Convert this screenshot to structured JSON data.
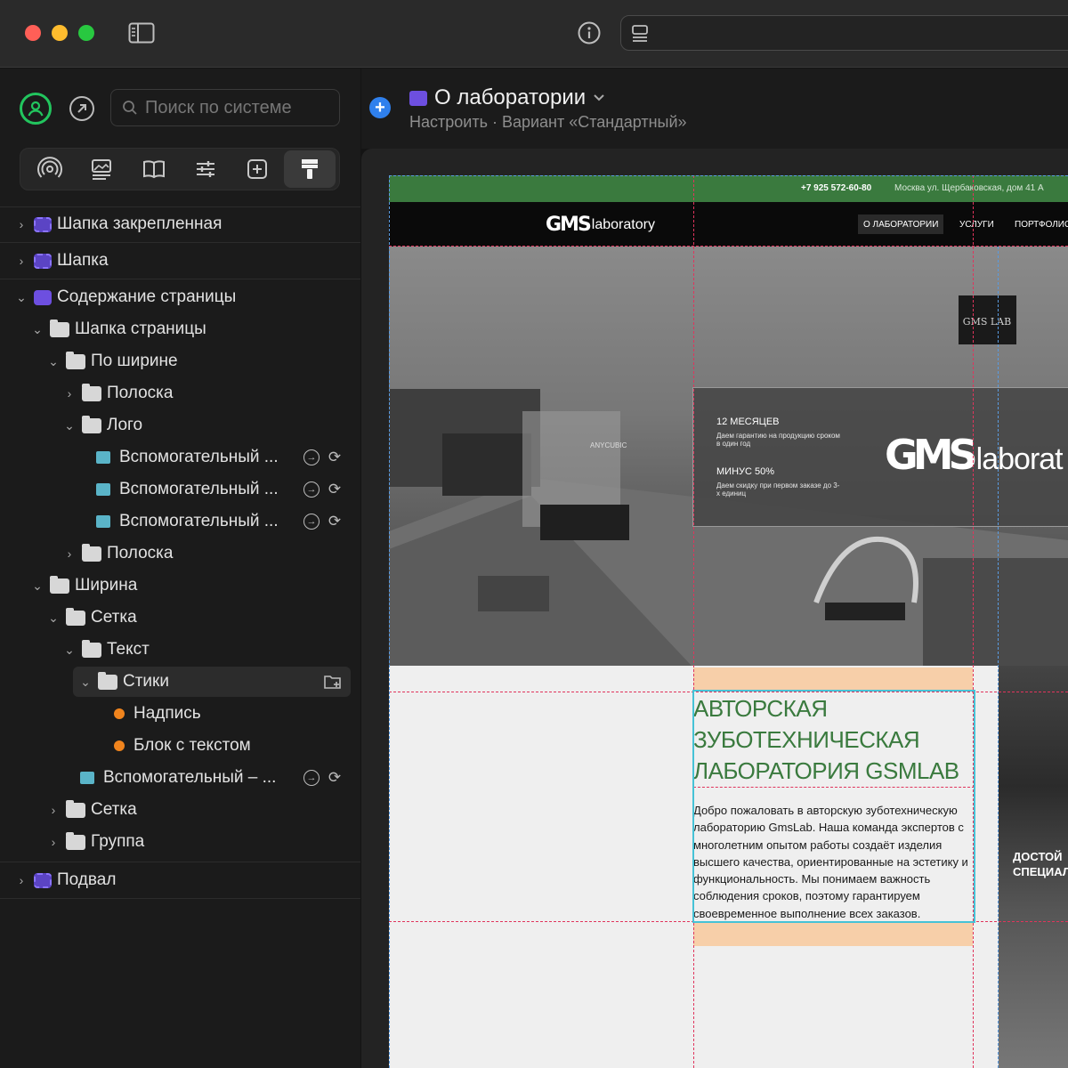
{
  "window": {
    "traffic_lights": {
      "close": "#ff5f57",
      "minimize": "#febc2e",
      "maximize": "#28c840"
    }
  },
  "sidebar": {
    "search_placeholder": "Поиск по системе",
    "toolbar_icons": [
      "broadcast-icon",
      "image-gallery-icon",
      "book-icon",
      "sliders-icon",
      "plus-square-icon",
      "paint-roller-icon"
    ],
    "tree": [
      {
        "label": "Шапка закрепленная",
        "type": "component",
        "expanded": false
      },
      {
        "label": "Шапка",
        "type": "component",
        "expanded": false
      },
      {
        "label": "Содержание страницы",
        "type": "component",
        "expanded": true
      },
      {
        "label": "Шапка страницы",
        "type": "folder",
        "expanded": true
      },
      {
        "label": "По ширине",
        "type": "folder",
        "expanded": true
      },
      {
        "label": "Полоска",
        "type": "folder",
        "expanded": false
      },
      {
        "label": "Лого",
        "type": "folder",
        "expanded": true
      },
      {
        "label": "Вспомогательный ...",
        "type": "auxiliary"
      },
      {
        "label": "Вспомогательный ...",
        "type": "auxiliary"
      },
      {
        "label": "Вспомогательный ...",
        "type": "auxiliary"
      },
      {
        "label": "Полоска",
        "type": "folder",
        "expanded": false
      },
      {
        "label": "Ширина",
        "type": "folder",
        "expanded": true
      },
      {
        "label": "Сетка",
        "type": "folder",
        "expanded": true
      },
      {
        "label": "Текст",
        "type": "folder",
        "expanded": true
      },
      {
        "label": "Стики",
        "type": "folder",
        "expanded": true,
        "selected": true
      },
      {
        "label": "Надпись",
        "type": "element"
      },
      {
        "label": "Блок с текстом",
        "type": "element"
      },
      {
        "label": "Вспомогательный – ...",
        "type": "auxiliary"
      },
      {
        "label": "Сетка",
        "type": "folder",
        "expanded": false
      },
      {
        "label": "Группа",
        "type": "folder",
        "expanded": false
      },
      {
        "label": "Подвал",
        "type": "component",
        "expanded": false
      }
    ]
  },
  "header": {
    "title": "О лаборатории",
    "subtitle": "Настроить · Вариант «Стандартный»"
  },
  "site": {
    "phone": "+7 925 572-60-80",
    "address": "Москва ул. Щербаковская, дом 41 А",
    "logo_mark": "GMS",
    "logo_text": "laboratory",
    "nav": [
      "О ЛАБОРАТОРИИ",
      "УСЛУГИ",
      "ПОРТФОЛИО"
    ],
    "card": {
      "h1": "12 МЕСЯЦЕВ",
      "p1": "Даем гарантию на продукцию сроком в один год",
      "h2": "МИНУС 50%",
      "p2": "Даем скидку при первом заказе до 3-х единиц",
      "logo_text": "laborat"
    },
    "sign_text": "GMS LAB",
    "printer_label": "ANYCUBIC",
    "heading": "АВТОРСКАЯ ЗУБОТЕХНИЧЕСКАЯ ЛАБОРАТОРИЯ GSMLAB",
    "body": "Добро пожаловать в авторскую зуботехническую лабораторию GmsLab. Наша команда экспертов с многолетним опытом работы создаёт изделия высшего качества, ориентированные на эстетику и функциональность. Мы понимаем важность соблюдения сроков, поэтому гарантируем своевременное выполнение всех заказов.",
    "side_text": "ДОСТОЙ СПЕЦИАЛ",
    "brand_green": "#3a7a3e",
    "accent_orange": "#f7cfa9"
  }
}
